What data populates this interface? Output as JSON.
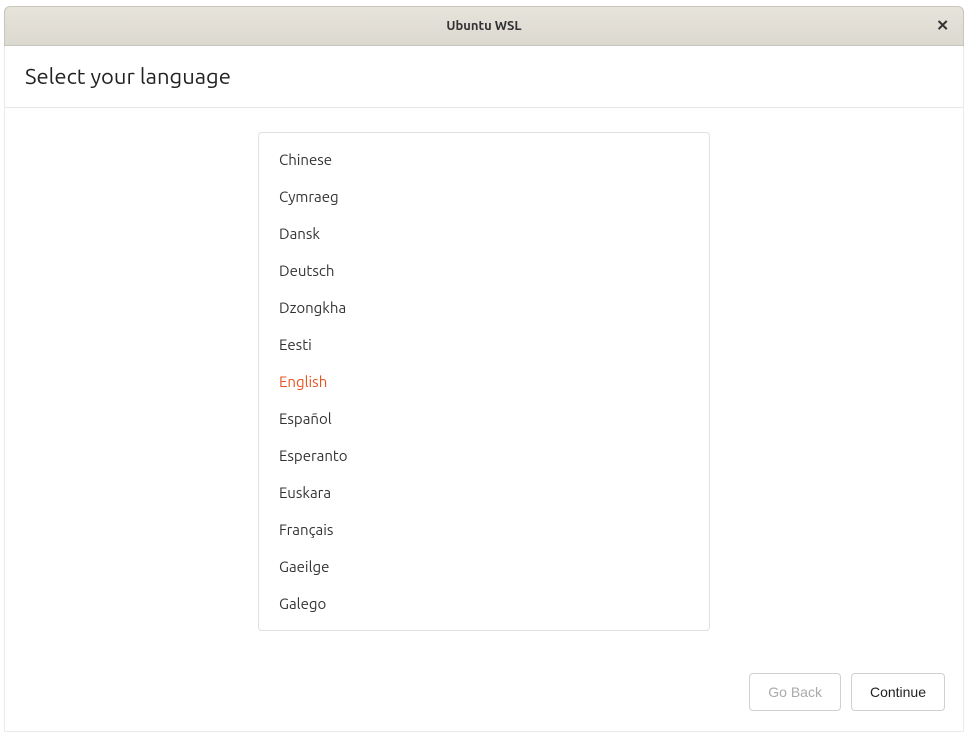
{
  "window": {
    "title": "Ubuntu WSL"
  },
  "header": {
    "title": "Select your language"
  },
  "languages": {
    "items": [
      {
        "label": "Chinese",
        "selected": false
      },
      {
        "label": "Cymraeg",
        "selected": false
      },
      {
        "label": "Dansk",
        "selected": false
      },
      {
        "label": "Deutsch",
        "selected": false
      },
      {
        "label": "Dzongkha",
        "selected": false
      },
      {
        "label": "Eesti",
        "selected": false
      },
      {
        "label": "English",
        "selected": true
      },
      {
        "label": "Español",
        "selected": false
      },
      {
        "label": "Esperanto",
        "selected": false
      },
      {
        "label": "Euskara",
        "selected": false
      },
      {
        "label": "Français",
        "selected": false
      },
      {
        "label": "Gaeilge",
        "selected": false
      },
      {
        "label": "Galego",
        "selected": false
      }
    ]
  },
  "footer": {
    "go_back_label": "Go Back",
    "continue_label": "Continue"
  },
  "colors": {
    "accent": "#e95420"
  }
}
